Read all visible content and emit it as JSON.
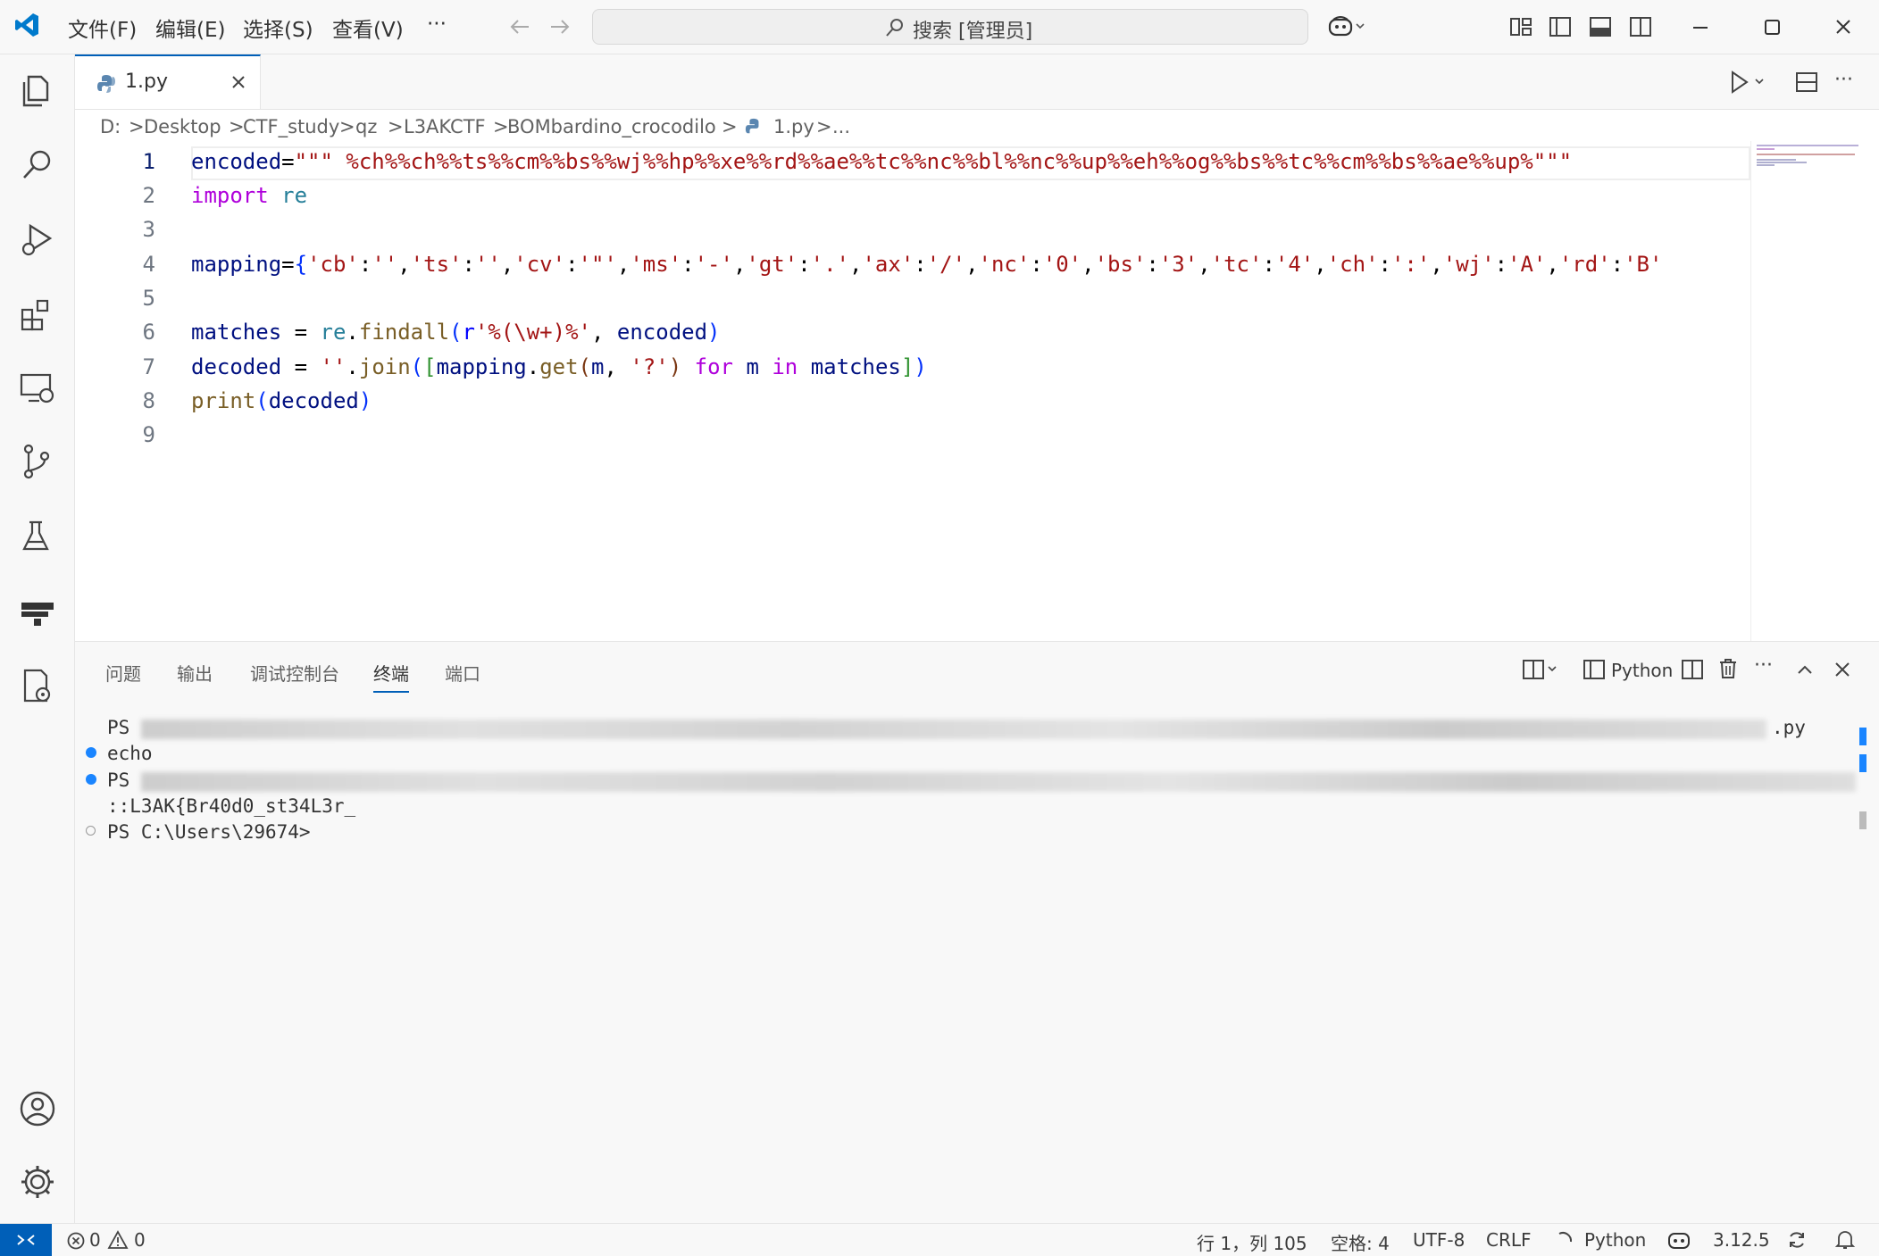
{
  "titlebar": {
    "menu": [
      "文件(F)",
      "编辑(E)",
      "选择(S)",
      "查看(V)",
      "···"
    ],
    "search_label": "搜索 [管理员]"
  },
  "tabs": [
    {
      "label": "1.py"
    }
  ],
  "breadcrumb": [
    "D:",
    "Desktop",
    "CTF_study",
    "qz",
    "L3AKCTF",
    "BOMbardino_crocodilo",
    "1.py",
    "..."
  ],
  "editor": {
    "line_numbers": [
      "1",
      "2",
      "3",
      "4",
      "5",
      "6",
      "7",
      "8",
      "9"
    ],
    "lines": [
      "encoded=\"\"\" %ch%%ch%%ts%%cm%%bs%%wj%%hp%%xe%%rd%%ae%%tc%%nc%%bl%%nc%%up%%eh%%og%%bs%%tc%%cm%%bs%%ae%%up%\"\"\"",
      "import re",
      "",
      "mapping={'cb':'','ts':'','cv':'\"','ms':'-','gt':'.','ax':'/','nc':'0','bs':'3','tc':'4','ch':':','wj':'A','rd':'B'",
      "",
      "matches = re.findall(r'%(\\w+)%', encoded)",
      "decoded = ''.join([mapping.get(m, '?') for m in matches])",
      "print(decoded)",
      ""
    ]
  },
  "panel": {
    "tabs": [
      "问题",
      "输出",
      "调试控制台",
      "终端",
      "端口"
    ],
    "active_tab": "终端",
    "terminal_name": "Python",
    "terminal_lines": [
      {
        "prefix": "PS",
        "text": "",
        "suffix": ".py"
      },
      {
        "prefix": "echo",
        "text": ""
      },
      {
        "prefix": "PS",
        "text": ""
      },
      {
        "prefix": "",
        "text": "::L3AK{Br40d0_st34L3r_"
      },
      {
        "prefix": "",
        "text": "PS C:\\Users\\29674>"
      }
    ]
  },
  "statusbar": {
    "errors": "0",
    "warnings": "0",
    "position": "行 1，列 105",
    "indent": "空格: 4",
    "encoding": "UTF-8",
    "eol": "CRLF",
    "language": "Python",
    "version": "3.12.5"
  },
  "colors": {
    "accent": "#005fb8",
    "keyword": "#af00db",
    "string": "#a31515"
  }
}
